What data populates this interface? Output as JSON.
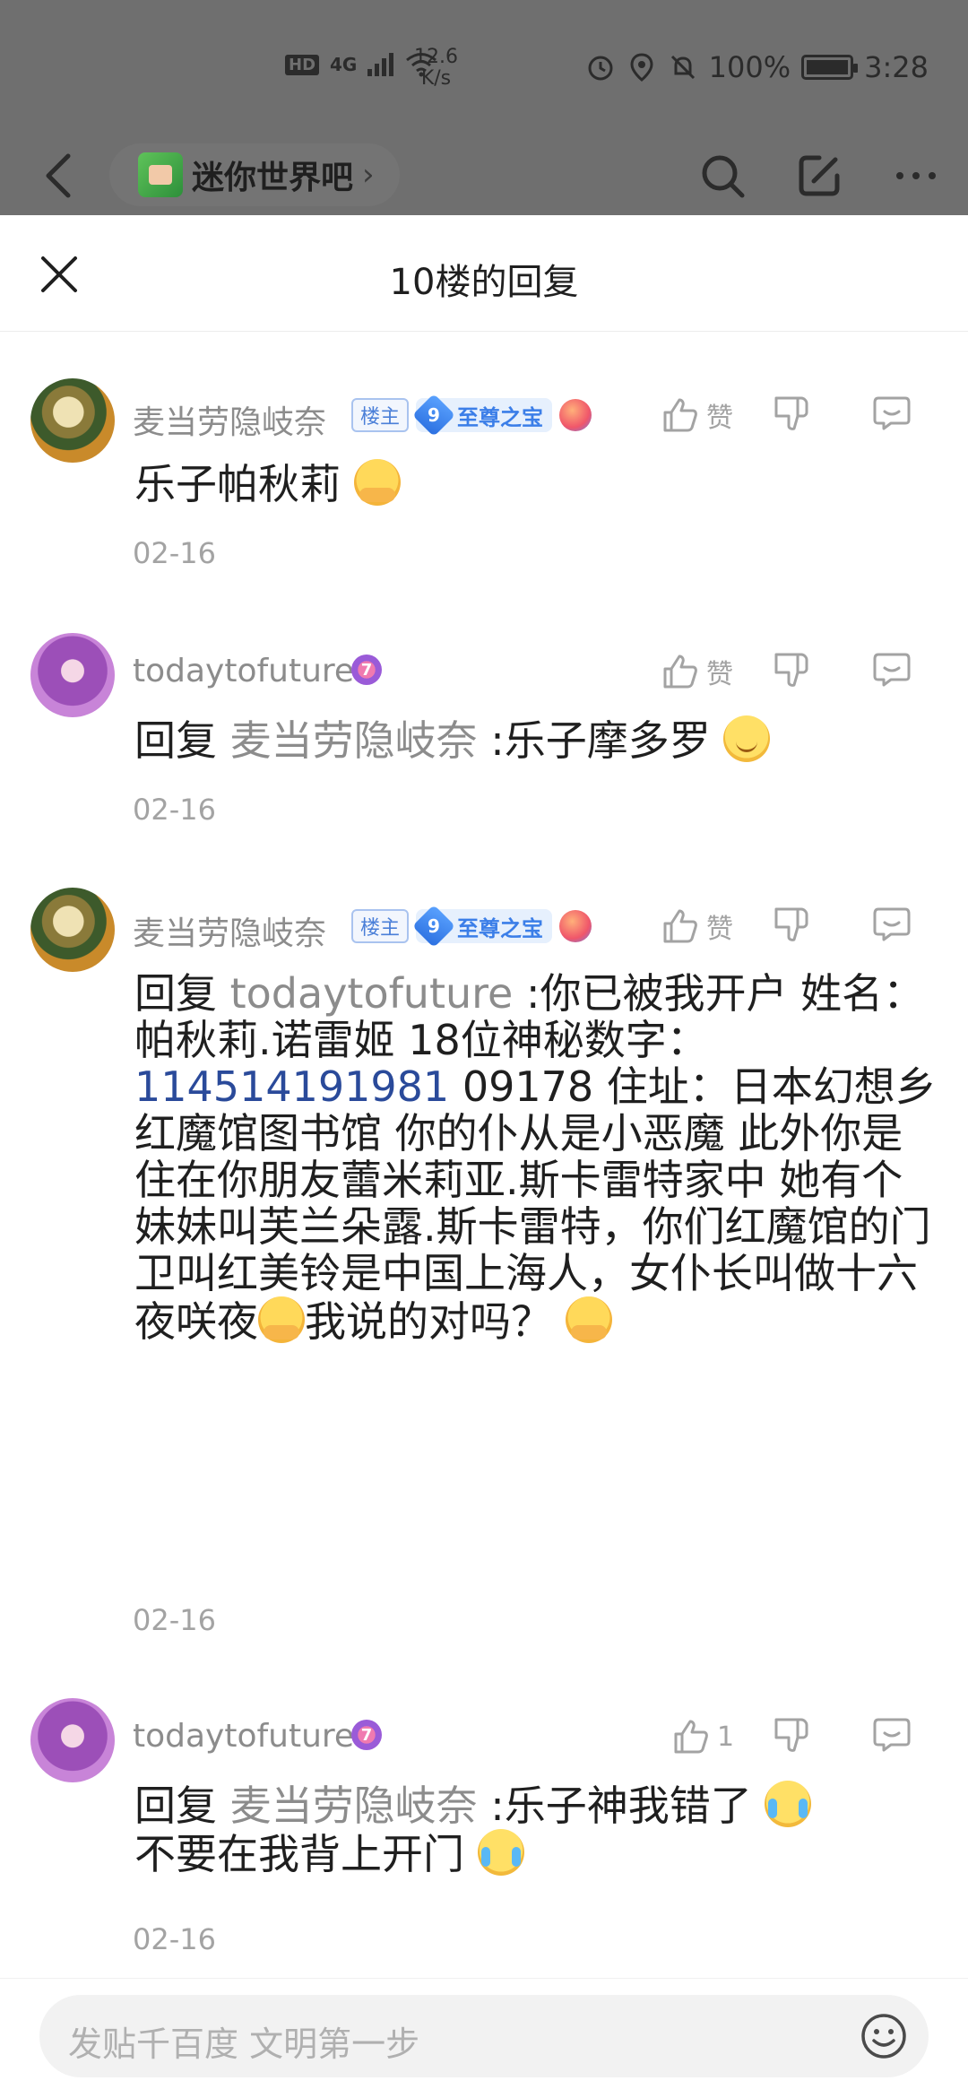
{
  "status_bar": {
    "hd": "HD",
    "network": "4G",
    "speed_value": "12.6",
    "speed_unit": "K/s",
    "battery": "100%",
    "time": "3:28"
  },
  "nav": {
    "forum_name": "迷你世界吧",
    "chevron": "›"
  },
  "sheet": {
    "title": "10楼的回复"
  },
  "replies": [
    {
      "username": "麦当劳隐岐奈",
      "owner_tag": "楼主",
      "level": "9",
      "level_title": "至尊之宝",
      "like_label": "赞",
      "content_text": "乐子帕秋莉",
      "date": "02-16"
    },
    {
      "username": "todaytofuture",
      "level": "7",
      "like_label": "赞",
      "reply_prefix": "回复 ",
      "reply_to": "麦当劳隐岐奈",
      "content_text": " :乐子摩多罗",
      "date": "02-16"
    },
    {
      "username": "麦当劳隐岐奈",
      "owner_tag": "楼主",
      "level": "9",
      "level_title": "至尊之宝",
      "like_label": "赞",
      "reply_prefix": "回复 ",
      "reply_to": "todaytofuture",
      "content_part1": " :你已被我开户 姓名：帕秋莉.诺雷姬 18位神秘数字：",
      "content_link": "114514191981",
      "content_part2": " 09178 住址：日本幻想乡红魔馆图书馆 你的仆从是小恶魔 此外你是住在你朋友蕾米莉亚.斯卡雷特家中 她有个妹妹叫芙兰朵露.斯卡雷特，你们红魔馆的门卫叫红美铃是中国上海人，女仆长叫做十六夜咲夜",
      "content_part3": "我说的对吗？",
      "date": "02-16"
    },
    {
      "username": "todaytofuture",
      "level": "7",
      "like_label": "1",
      "reply_prefix": "回复 ",
      "reply_to": "麦当劳隐岐奈",
      "content_part1": " :乐子神我错了",
      "content_part2": "不要在我背上开门",
      "date": "02-16"
    }
  ],
  "input": {
    "placeholder": "发贴千百度 文明第一步"
  },
  "icons": [
    "back-icon",
    "search-icon",
    "edit-icon",
    "more-icon",
    "close-icon",
    "thumb-up-icon",
    "thumb-down-icon",
    "comment-icon",
    "emoji-icon"
  ]
}
